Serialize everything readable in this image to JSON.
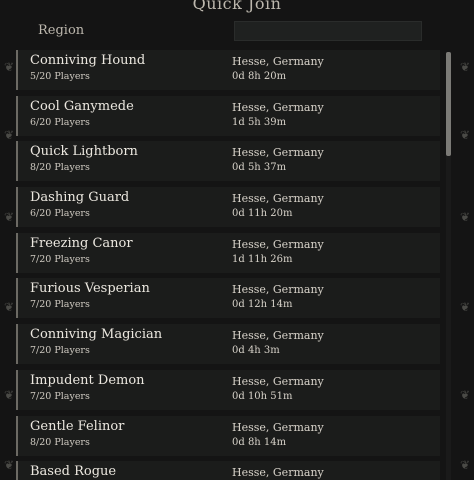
{
  "window": {
    "title": "Quick Join"
  },
  "filters": {
    "region_label": "Region",
    "region_value": ""
  },
  "servers": [
    {
      "name": "Conniving Hound",
      "players": "5/20 Players",
      "location": "Hesse, Germany",
      "uptime": "0d 8h 20m"
    },
    {
      "name": "Cool Ganymede",
      "players": "6/20 Players",
      "location": "Hesse, Germany",
      "uptime": "1d 5h 39m"
    },
    {
      "name": "Quick Lightborn",
      "players": "8/20 Players",
      "location": "Hesse, Germany",
      "uptime": "0d 5h 37m"
    },
    {
      "name": "Dashing Guard",
      "players": "6/20 Players",
      "location": "Hesse, Germany",
      "uptime": "0d 11h 20m"
    },
    {
      "name": "Freezing Canor",
      "players": "7/20 Players",
      "location": "Hesse, Germany",
      "uptime": "1d 11h 26m"
    },
    {
      "name": "Furious Vesperian",
      "players": "7/20 Players",
      "location": "Hesse, Germany",
      "uptime": "0d 12h 14m"
    },
    {
      "name": "Conniving Magician",
      "players": "7/20 Players",
      "location": "Hesse, Germany",
      "uptime": "0d 4h 3m"
    },
    {
      "name": "Impudent Demon",
      "players": "7/20 Players",
      "location": "Hesse, Germany",
      "uptime": "0d 10h 51m"
    },
    {
      "name": "Gentle Felinor",
      "players": "8/20 Players",
      "location": "Hesse, Germany",
      "uptime": "0d 8h 14m"
    },
    {
      "name": "Based Rogue",
      "players": "",
      "location": "Hesse, Germany",
      "uptime": ""
    }
  ],
  "scroll": {
    "position": 0
  },
  "colors": {
    "background": "#141414",
    "row": "#1b1c1b",
    "row_accent": "#6c6a64",
    "text": "#ece8e0",
    "thumb": "#7b7a76"
  },
  "icons": {
    "ornament": "scroll-ornament-icon"
  }
}
